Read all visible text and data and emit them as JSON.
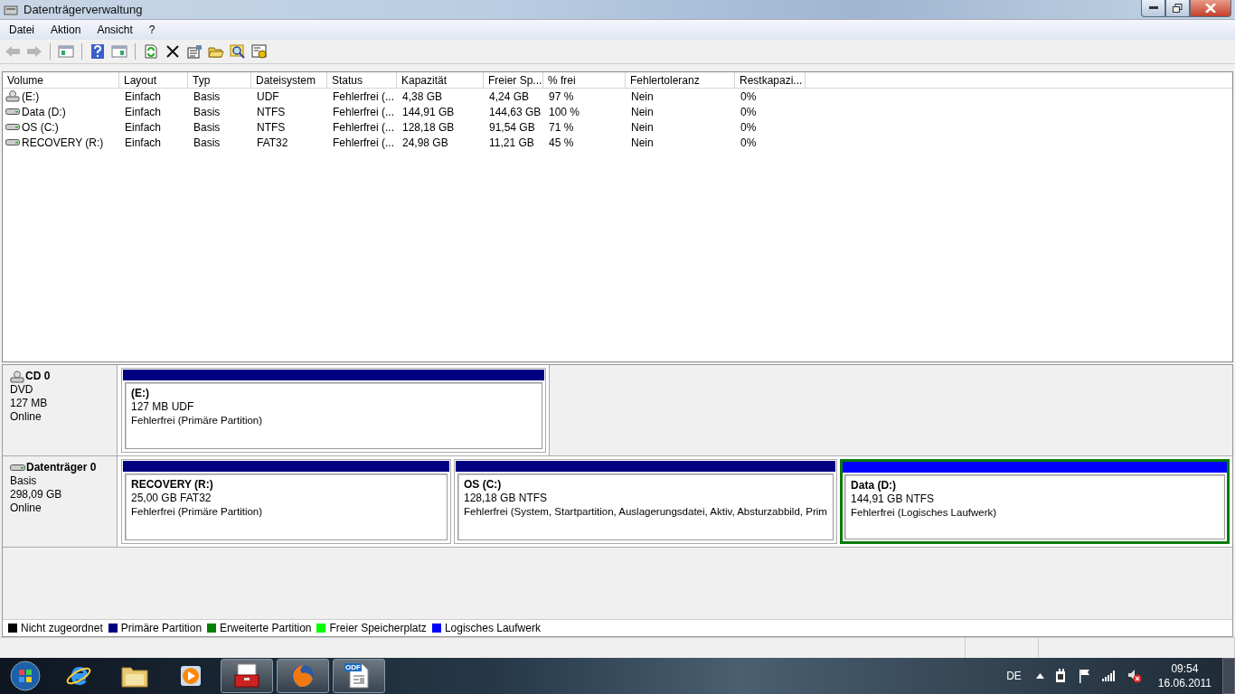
{
  "window": {
    "title": "Datenträgerverwaltung"
  },
  "menu": [
    "Datei",
    "Aktion",
    "Ansicht",
    "?"
  ],
  "toolbar": [
    {
      "kind": "back",
      "disabled": true
    },
    {
      "kind": "forward",
      "disabled": true
    },
    {
      "kind": "sep"
    },
    {
      "kind": "tree",
      "disabled": false
    },
    {
      "kind": "sep"
    },
    {
      "kind": "help",
      "disabled": false
    },
    {
      "kind": "pane",
      "disabled": false
    },
    {
      "kind": "sep"
    },
    {
      "kind": "refresh",
      "disabled": false
    },
    {
      "kind": "delete",
      "disabled": false
    },
    {
      "kind": "properties",
      "disabled": false
    },
    {
      "kind": "open",
      "disabled": false
    },
    {
      "kind": "search",
      "disabled": false
    },
    {
      "kind": "settings",
      "disabled": false
    }
  ],
  "table": {
    "columns": [
      "Volume",
      "Layout",
      "Typ",
      "Dateisystem",
      "Status",
      "Kapazität",
      "Freier Sp...",
      "% frei",
      "Fehlertoleranz",
      "Restkapazi..."
    ],
    "rows": [
      {
        "kind": "cd",
        "cells": [
          "(E:)",
          "Einfach",
          "Basis",
          "UDF",
          "Fehlerfrei (...",
          "4,38 GB",
          "4,24 GB",
          "97 %",
          "Nein",
          "0%"
        ]
      },
      {
        "kind": "disk",
        "cells": [
          "Data (D:)",
          "Einfach",
          "Basis",
          "NTFS",
          "Fehlerfrei (...",
          "144,91 GB",
          "144,63 GB",
          "100 %",
          "Nein",
          "0%"
        ]
      },
      {
        "kind": "disk",
        "cells": [
          "OS (C:)",
          "Einfach",
          "Basis",
          "NTFS",
          "Fehlerfrei (...",
          "128,18 GB",
          "91,54 GB",
          "71 %",
          "Nein",
          "0%"
        ]
      },
      {
        "kind": "disk",
        "cells": [
          "RECOVERY (R:)",
          "Einfach",
          "Basis",
          "FAT32",
          "Fehlerfrei (...",
          "24,98 GB",
          "11,21 GB",
          "45 %",
          "Nein",
          "0%"
        ]
      }
    ]
  },
  "disks": [
    {
      "kind": "cd",
      "name": "CD 0",
      "type": "DVD",
      "size": "127 MB",
      "state": "Online",
      "partitions": [
        {
          "name": "(E:)",
          "size": "127 MB UDF",
          "status": "Fehlerfrei (Primäre Partition)",
          "color": "#000080",
          "selected": false
        }
      ]
    },
    {
      "kind": "disk",
      "name": "Datenträger 0",
      "type": "Basis",
      "size": "298,09 GB",
      "state": "Online",
      "partitions": [
        {
          "name": "RECOVERY  (R:)",
          "size": "25,00 GB FAT32",
          "status": "Fehlerfrei (Primäre Partition)",
          "color": "#000080",
          "selected": false
        },
        {
          "name": "OS  (C:)",
          "size": "128,18 GB NTFS",
          "status": "Fehlerfrei (System, Startpartition, Auslagerungsdatei, Aktiv, Absturzabbild, Prim",
          "color": "#000080",
          "selected": false
        },
        {
          "name": "Data  (D:)",
          "size": "144,91 GB NTFS",
          "status": "Fehlerfrei (Logisches Laufwerk)",
          "color": "#0000ff",
          "selected": true
        }
      ]
    }
  ],
  "legend": [
    {
      "label": "Nicht zugeordnet",
      "color": "#000000"
    },
    {
      "label": "Primäre Partition",
      "color": "#000080"
    },
    {
      "label": "Erweiterte Partition",
      "color": "#008000"
    },
    {
      "label": "Freier Speicherplatz",
      "color": "#00ff00"
    },
    {
      "label": "Logisches Laufwerk",
      "color": "#0000ff"
    }
  ],
  "taskbar": {
    "apps": [
      {
        "kind": "ie",
        "active": false
      },
      {
        "kind": "folder",
        "active": false
      },
      {
        "kind": "media",
        "active": false
      },
      {
        "kind": "toolbox",
        "active": true
      },
      {
        "kind": "firefox",
        "active": true
      },
      {
        "kind": "odf",
        "active": true,
        "badge": "ODF"
      }
    ],
    "language": "DE",
    "time": "09:54",
    "date": "16.06.2011"
  }
}
